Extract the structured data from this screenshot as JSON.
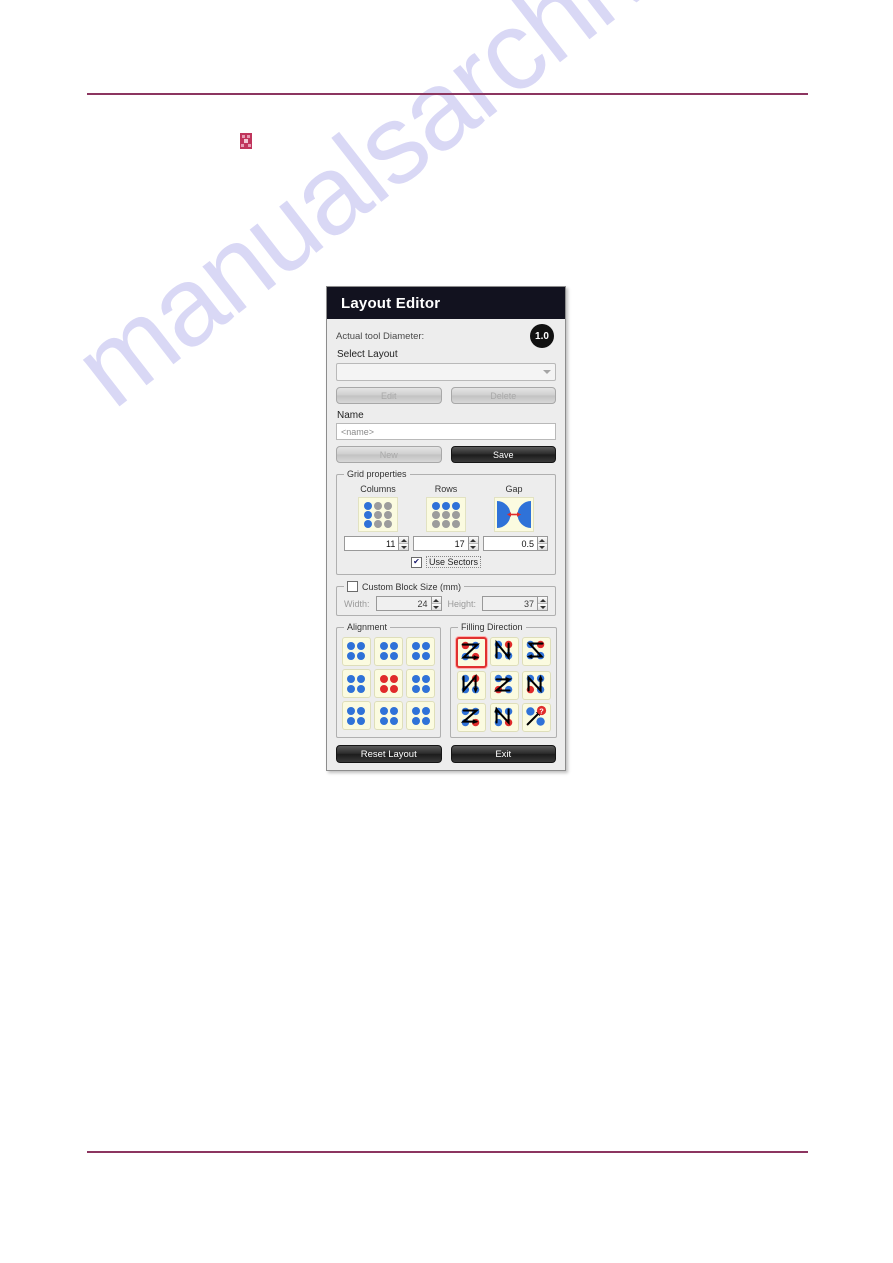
{
  "page": {
    "watermark_text": "manualsarchive.com",
    "rule_color": "#8c3560",
    "broken_image_icon": "broken-image-icon"
  },
  "dialog": {
    "title": "Layout Editor",
    "tool_diameter_label": "Actual tool Diameter:",
    "tool_diameter_value": "1.0",
    "select_layout_label": "Select Layout",
    "select_layout_value": "",
    "edit_button": "Edit",
    "delete_button": "Delete",
    "name_label": "Name",
    "name_placeholder": "<name>",
    "name_value": "<name>",
    "new_button": "New",
    "save_button": "Save",
    "grid_properties": {
      "title": "Grid properties",
      "columns": {
        "label": "Columns",
        "value": "11",
        "icon": "columns-grid-icon"
      },
      "rows": {
        "label": "Rows",
        "value": "17",
        "icon": "rows-grid-icon"
      },
      "gap": {
        "label": "Gap",
        "value": "0.5",
        "icon": "gap-spacing-icon"
      },
      "use_sectors_label": "Use Sectors",
      "use_sectors_checked": true,
      "check_glyph": "✔"
    },
    "custom_block_size": {
      "title": "Custom Block Size (mm)",
      "checked": false,
      "width_label": "Width:",
      "width_value": "24",
      "height_label": "Height:",
      "height_value": "37"
    },
    "alignment": {
      "title": "Alignment",
      "selected_index": 4,
      "options": [
        "align-top-left",
        "align-top-center",
        "align-top-right",
        "align-middle-left",
        "align-middle-center",
        "align-middle-right",
        "align-bottom-left",
        "align-bottom-center",
        "align-bottom-right"
      ]
    },
    "filling_direction": {
      "title": "Filling Direction",
      "selected_index": 0,
      "options": [
        "fill-z-horizontal-down",
        "fill-n-vertical-down",
        "fill-s-horizontal-reverse",
        "fill-n-vertical-up",
        "fill-s-horizontal-alt",
        "fill-n-vertical-alt",
        "fill-z-horizontal-up",
        "fill-n-vertical-mixed",
        "fill-custom-unknown"
      ]
    },
    "reset_button": "Reset Layout",
    "exit_button": "Exit"
  },
  "colors": {
    "titlebar_bg": "#12121f",
    "dot_blue": "#2f72d8",
    "dot_red": "#e02b2b",
    "dot_gray": "#9c9c9c",
    "tile_bg": "#fbfbe0",
    "accent_select": "#e03030"
  }
}
